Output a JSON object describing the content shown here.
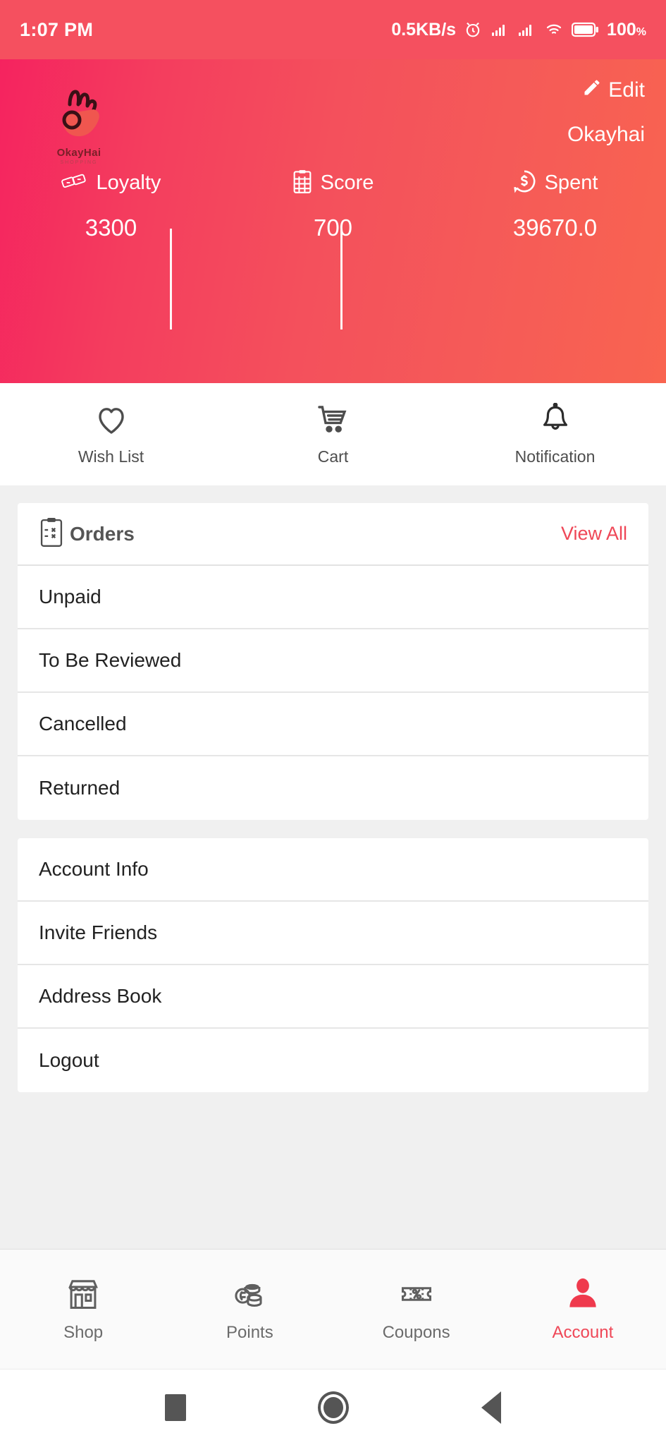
{
  "statusbar": {
    "time": "1:07 PM",
    "network_speed": "0.5KB/s",
    "battery_percent": "100",
    "battery_unit": "%",
    "icons": [
      "alarm-icon",
      "signal-icon",
      "signal-icon",
      "wifi-icon",
      "battery-icon"
    ]
  },
  "header": {
    "edit_label": "Edit",
    "username": "Okayhai",
    "brand_name": "OkayHai",
    "brand_sub": "SHOPPING",
    "gradient_from": "#f5235f",
    "gradient_to": "#f96450",
    "stats": [
      {
        "label": "Loyalty",
        "value": "3300",
        "icon": "loyalty-card-icon"
      },
      {
        "label": "Score",
        "value": "700",
        "icon": "score-clipboard-icon"
      },
      {
        "label": "Spent",
        "value": "39670.0",
        "icon": "dollar-coin-icon"
      }
    ]
  },
  "quick_actions": [
    {
      "label": "Wish List",
      "icon": "heart-icon"
    },
    {
      "label": "Cart",
      "icon": "cart-icon"
    },
    {
      "label": "Notification",
      "icon": "bell-icon"
    }
  ],
  "orders_card": {
    "title": "Orders",
    "icon": "orders-clipboard-icon",
    "view_all": "View All",
    "rows": [
      "Unpaid",
      "To Be Reviewed",
      "Cancelled",
      "Returned"
    ]
  },
  "account_card": {
    "rows": [
      "Account Info",
      "Invite Friends",
      "Address Book",
      "Logout"
    ]
  },
  "tabbar": {
    "accent_color": "#ef4757",
    "items": [
      {
        "label": "Shop",
        "icon": "store-icon",
        "active": false
      },
      {
        "label": "Points",
        "icon": "coins-icon",
        "active": false
      },
      {
        "label": "Coupons",
        "icon": "coupon-icon",
        "active": false
      },
      {
        "label": "Account",
        "icon": "person-icon",
        "active": true
      }
    ]
  },
  "android_nav": {
    "buttons": [
      "recents-square-icon",
      "home-circle-icon",
      "back-triangle-icon"
    ]
  }
}
